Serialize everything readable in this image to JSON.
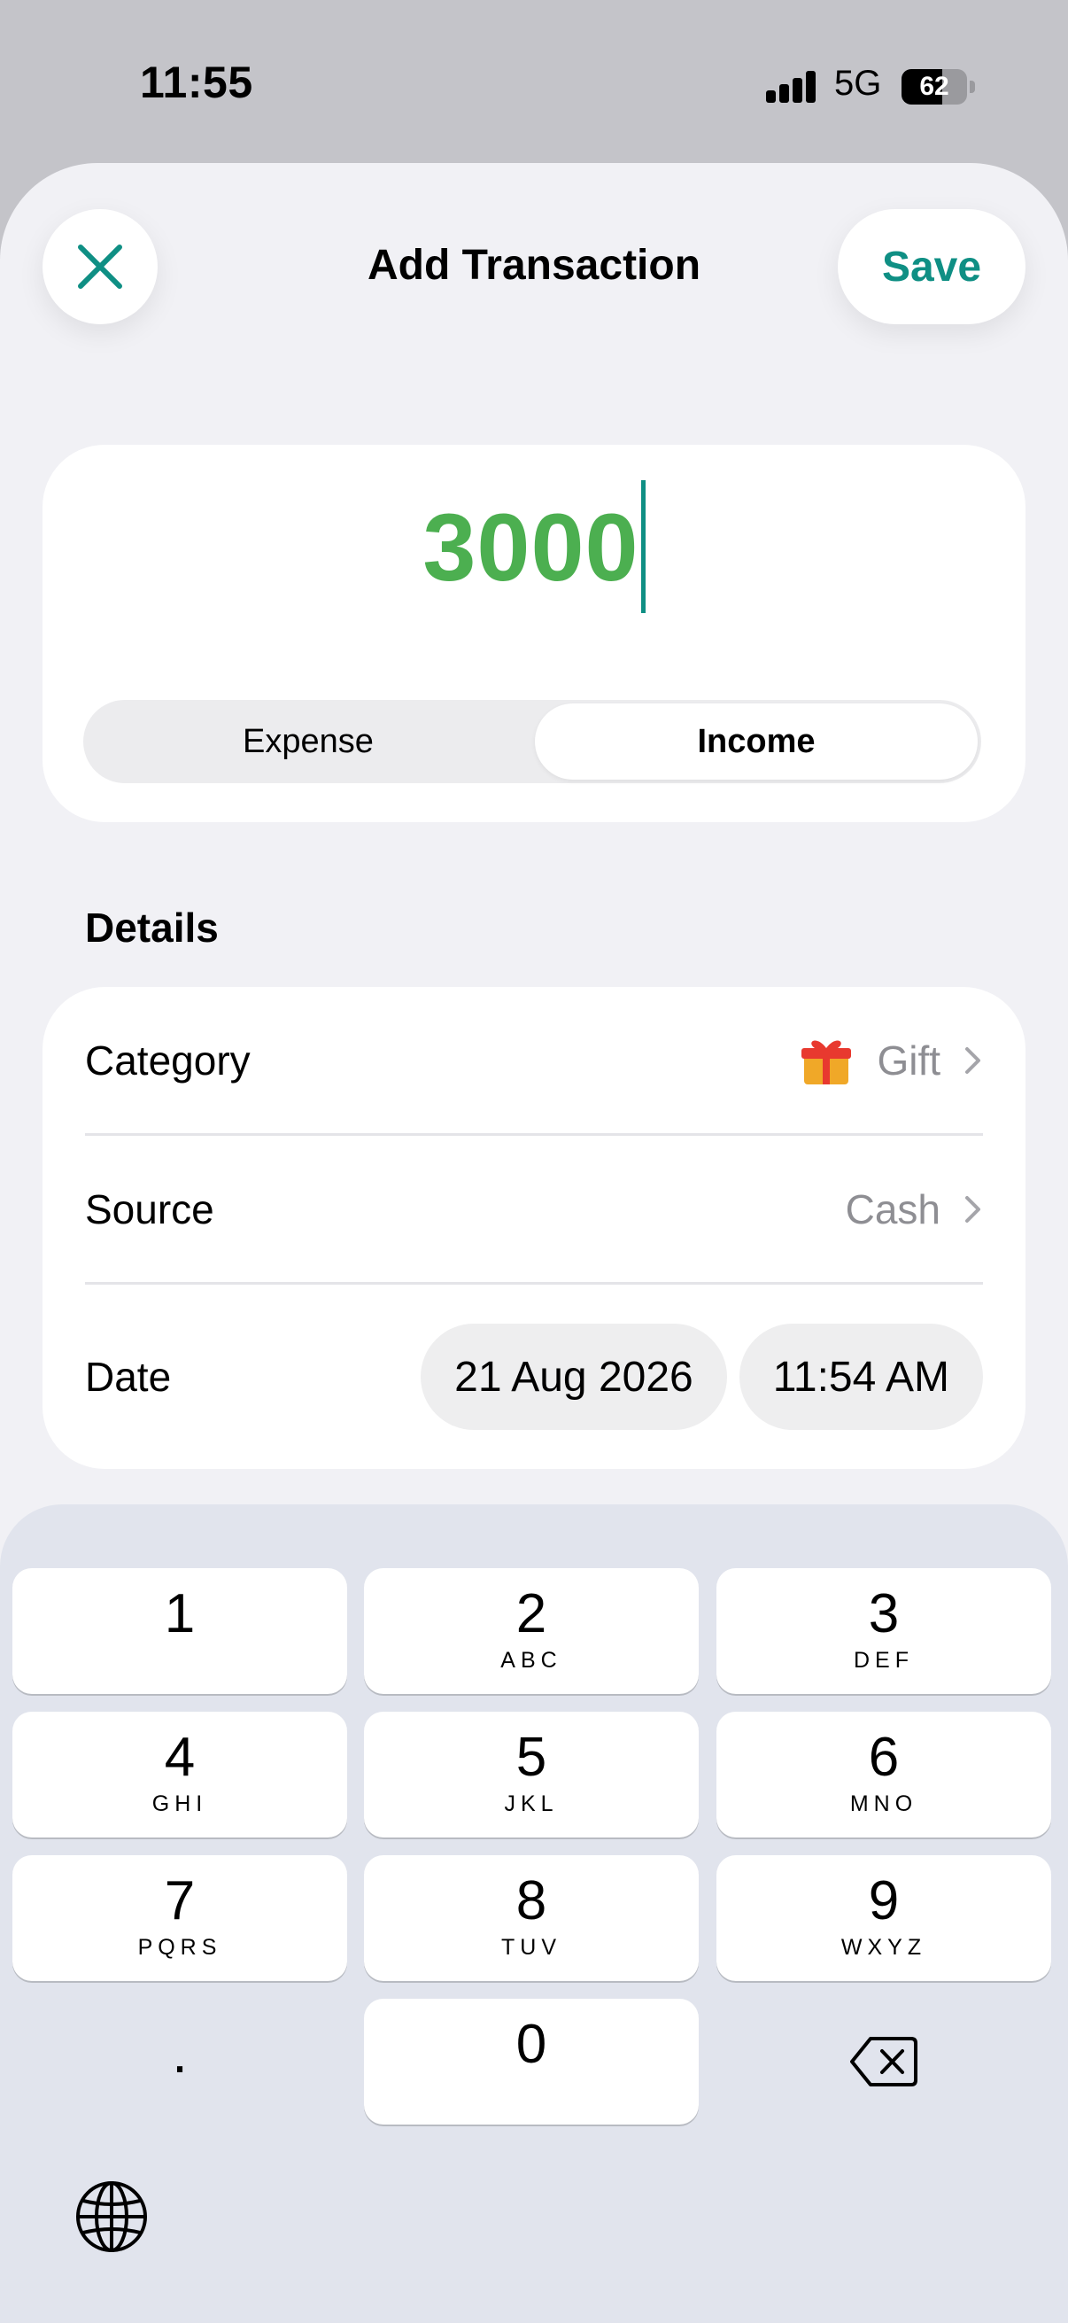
{
  "status_bar": {
    "time": "11:55",
    "network": "5G",
    "battery_level": 62
  },
  "header": {
    "title": "Add Transaction",
    "save_label": "Save",
    "close_icon": "close-icon"
  },
  "amount": {
    "value": "3000",
    "color": "#4caf50"
  },
  "type_toggle": {
    "options": [
      "Expense",
      "Income"
    ],
    "selected": "Income"
  },
  "details": {
    "heading": "Details",
    "category": {
      "label": "Category",
      "value": "Gift",
      "icon": "gift-icon"
    },
    "source": {
      "label": "Source",
      "value": "Cash"
    },
    "date": {
      "label": "Date",
      "date_value": "21 Aug 2026",
      "time_value": "11:54 AM"
    }
  },
  "keypad": {
    "keys": [
      {
        "digit": "1",
        "letters": ""
      },
      {
        "digit": "2",
        "letters": "ABC"
      },
      {
        "digit": "3",
        "letters": "DEF"
      },
      {
        "digit": "4",
        "letters": "GHI"
      },
      {
        "digit": "5",
        "letters": "JKL"
      },
      {
        "digit": "6",
        "letters": "MNO"
      },
      {
        "digit": "7",
        "letters": "PQRS"
      },
      {
        "digit": "8",
        "letters": "TUV"
      },
      {
        "digit": "9",
        "letters": "WXYZ"
      },
      {
        "digit": "0",
        "letters": ""
      }
    ],
    "decimal": ".",
    "delete_icon": "delete-icon",
    "globe_icon": "globe-icon"
  },
  "colors": {
    "accent": "#0f8f84",
    "income_green": "#4caf50"
  }
}
